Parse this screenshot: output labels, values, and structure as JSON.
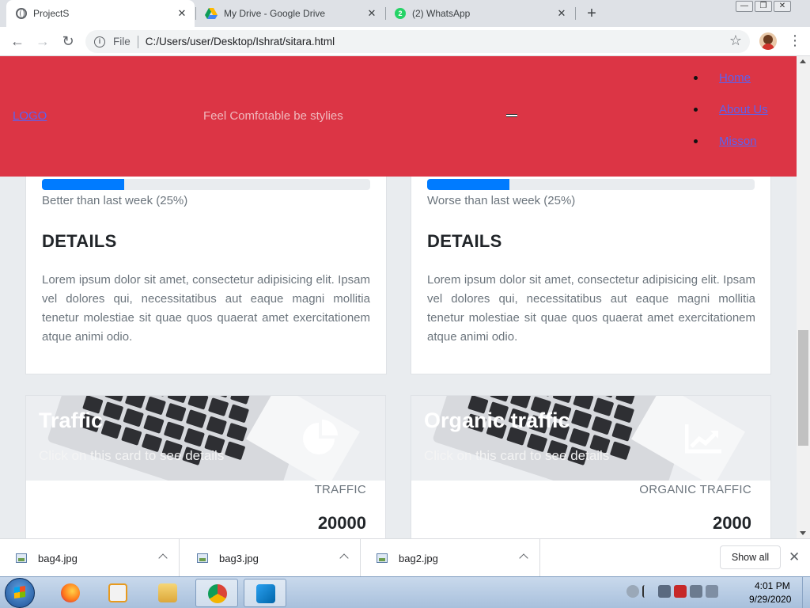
{
  "browser": {
    "tabs": [
      {
        "title": "ProjectS",
        "active": true,
        "icon": "globe-icon"
      },
      {
        "title": "My Drive - Google Drive",
        "active": false,
        "icon": "google-drive-icon"
      },
      {
        "title": "(2) WhatsApp",
        "active": false,
        "icon": "whatsapp-icon",
        "badge": "2"
      }
    ],
    "new_tab_glyph": "+",
    "address": {
      "scheme_label": "File",
      "url": "C:/Users/user/Desktop/Ishrat/sitara.html"
    }
  },
  "site": {
    "header": {
      "logo": "LOGO",
      "tagline": "Feel Comfotable be stylies",
      "nav": [
        "Home",
        "About Us",
        "Misson"
      ]
    },
    "stat_cards": [
      {
        "progress_value": 0.25,
        "progress_text": "Better than last week (25%)",
        "details_title": "DETAILS",
        "details_body": "Lorem ipsum dolor sit amet, consectetur adipisicing elit. Ipsam vel dolores qui, necessitatibus aut eaque magni mollitia tenetur molestiae sit quae quos quaerat amet exercitationem atque animi odio."
      },
      {
        "progress_value": 0.25,
        "progress_text": "Worse than last week (25%)",
        "details_title": "DETAILS",
        "details_body": "Lorem ipsum dolor sit amet, consectetur adipisicing elit. Ipsam vel dolores qui, necessitatibus aut eaque magni mollitia tenetur molestiae sit quae quos quaerat amet exercitationem atque animi odio."
      }
    ],
    "image_cards": [
      {
        "title": "Traffic",
        "subtitle": "Click on this card to see details",
        "icon": "pie-chart-icon",
        "stat_label": "TRAFFIC",
        "stat_value": "20000"
      },
      {
        "title": "Organic traffic",
        "subtitle": "Click on this card to see details",
        "icon": "line-chart-icon",
        "stat_label": "ORGANIC TRAFFIC",
        "stat_value": "2000"
      }
    ]
  },
  "downloads": {
    "items": [
      "bag4.jpg",
      "bag3.jpg",
      "bag2.jpg"
    ],
    "show_all": "Show all"
  },
  "taskbar": {
    "apps": [
      "firefox-icon",
      "media-player-icon",
      "file-explorer-icon",
      "chrome-icon",
      "vscode-icon"
    ],
    "time": "4:01 PM",
    "date": "9/29/2020"
  },
  "colors": {
    "header_bg": "#dc3545",
    "link": "#5b62f0",
    "progress": "#007bff"
  }
}
